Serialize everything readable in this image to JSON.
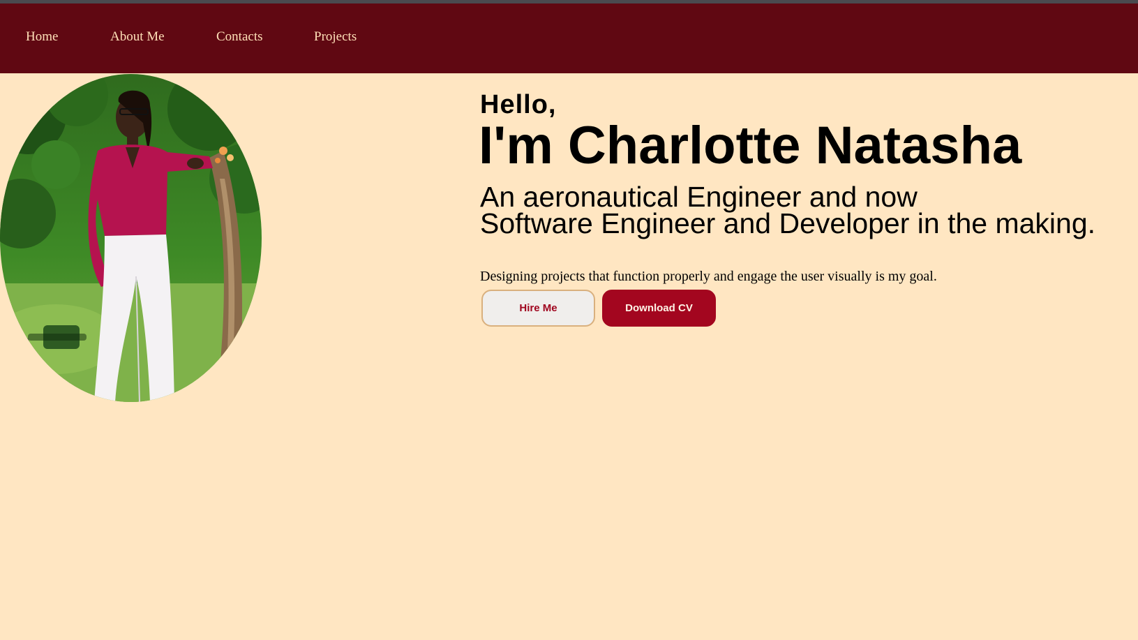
{
  "nav": {
    "items": [
      {
        "label": "Home"
      },
      {
        "label": "About Me"
      },
      {
        "label": "Contacts"
      },
      {
        "label": "Projects"
      }
    ]
  },
  "hero": {
    "greeting": "Hello,",
    "name": "I'm Charlotte Natasha",
    "tagline_line1": "An aeronautical Engineer and now",
    "tagline_line2": "Software Engineer and Developer in the making.",
    "goal": "Designing projects that function properly and engage the user visually is my goal.",
    "hire_label": "Hire Me",
    "cv_label": "Download CV"
  },
  "colors": {
    "background": "#ffe6c2",
    "navbar": "#600812",
    "nav_text": "#ffe0b8",
    "accent": "#a3061f"
  }
}
